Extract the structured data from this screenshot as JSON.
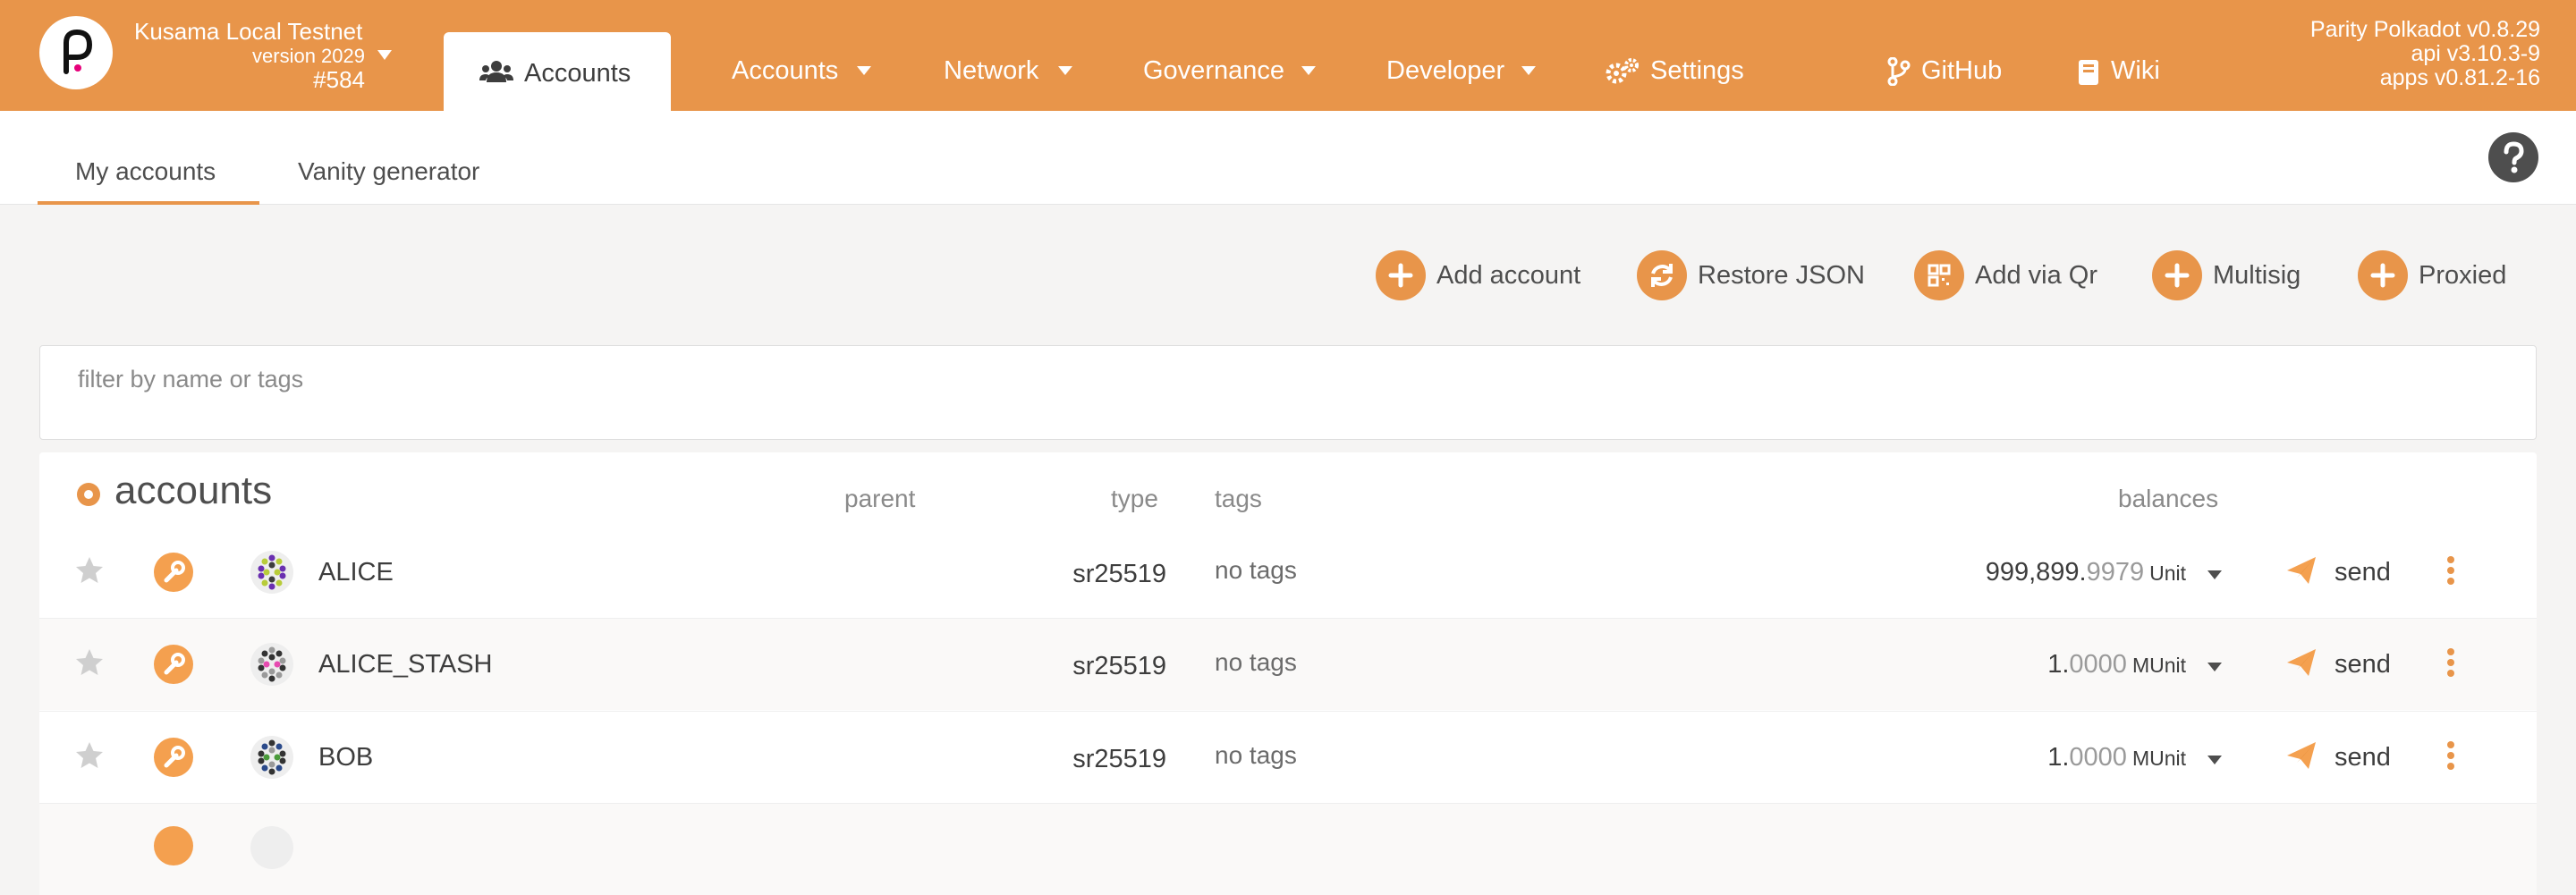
{
  "header": {
    "chain_name": "Kusama Local Testnet",
    "version": "version 2029",
    "block": "#584",
    "active_tab": "Accounts",
    "nav": [
      {
        "label": "Accounts",
        "dropdown": true
      },
      {
        "label": "Network",
        "dropdown": true
      },
      {
        "label": "Governance",
        "dropdown": true
      },
      {
        "label": "Developer",
        "dropdown": true
      },
      {
        "label": "Settings",
        "icon": "gears-icon"
      },
      {
        "label": "GitHub",
        "icon": "code-branch-icon"
      },
      {
        "label": "Wiki",
        "icon": "book-icon"
      }
    ],
    "versions": [
      "Parity Polkadot v0.8.29",
      "api v3.10.3-9",
      "apps v0.81.2-16"
    ],
    "accent_color": "#e8954a"
  },
  "subtabs": [
    {
      "label": "My accounts",
      "active": true
    },
    {
      "label": "Vanity generator",
      "active": false
    }
  ],
  "actions": [
    {
      "label": "Add account",
      "icon": "plus-icon"
    },
    {
      "label": "Restore JSON",
      "icon": "sync-icon"
    },
    {
      "label": "Add via Qr",
      "icon": "qrcode-icon"
    },
    {
      "label": "Multisig",
      "icon": "plus-icon"
    },
    {
      "label": "Proxied",
      "icon": "plus-icon"
    }
  ],
  "filter": {
    "placeholder": "filter by name or tags",
    "value": ""
  },
  "table": {
    "title": "accounts",
    "columns": {
      "parent": "parent",
      "type": "type",
      "tags": "tags",
      "balances": "balances"
    },
    "rows": [
      {
        "name": "ALICE",
        "type": "sr25519",
        "tags": "no tags",
        "balance_int": "999,899.",
        "balance_dec": "9979",
        "unit": "Unit",
        "send": "send"
      },
      {
        "name": "ALICE_STASH",
        "type": "sr25519",
        "tags": "no tags",
        "balance_int": "1.",
        "balance_dec": "0000",
        "unit": "MUnit",
        "send": "send"
      },
      {
        "name": "BOB",
        "type": "sr25519",
        "tags": "no tags",
        "balance_int": "1.",
        "balance_dec": "0000",
        "unit": "MUnit",
        "send": "send"
      }
    ]
  }
}
